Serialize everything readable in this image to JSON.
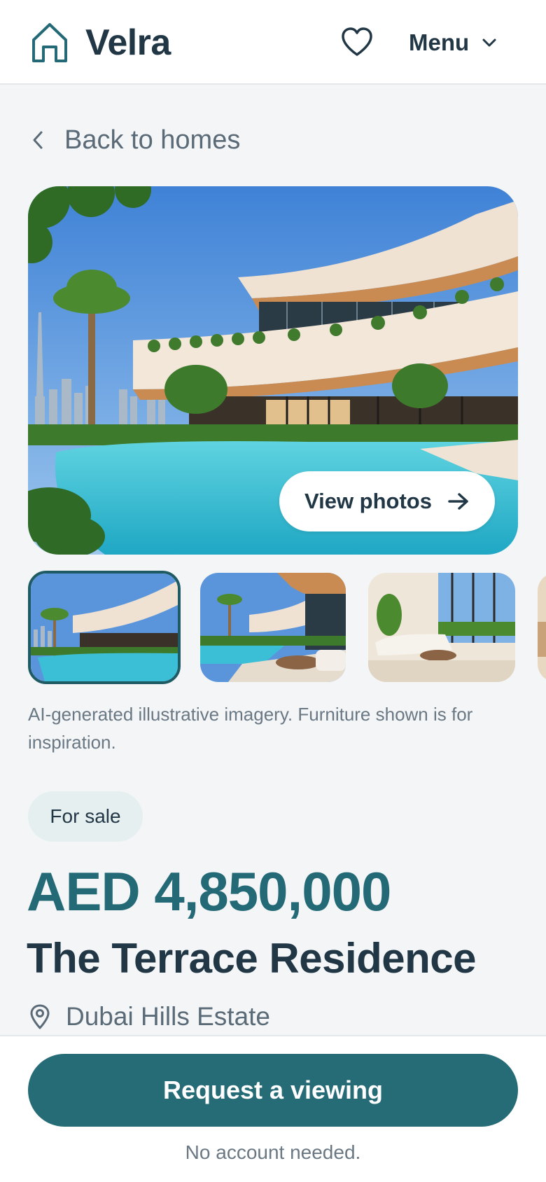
{
  "header": {
    "brand": "Velra",
    "menu_label": "Menu"
  },
  "nav": {
    "back_label": "Back to homes"
  },
  "gallery": {
    "view_photos_label": "View photos",
    "selected_index": 0,
    "disclaimer": "AI-generated illustrative imagery. Furniture shown is for inspiration."
  },
  "listing": {
    "status_badge": "For sale",
    "price": "AED 4,850,000",
    "title": "The Terrace Residence",
    "location": "Dubai Hills Estate"
  },
  "cta": {
    "label": "Request a viewing",
    "note": "No account needed."
  },
  "colors": {
    "brand_teal": "#256c76",
    "price_teal": "#236a76",
    "text_dark": "#223746",
    "text_muted": "#5a6b77",
    "page_bg": "#f3f5f7"
  }
}
